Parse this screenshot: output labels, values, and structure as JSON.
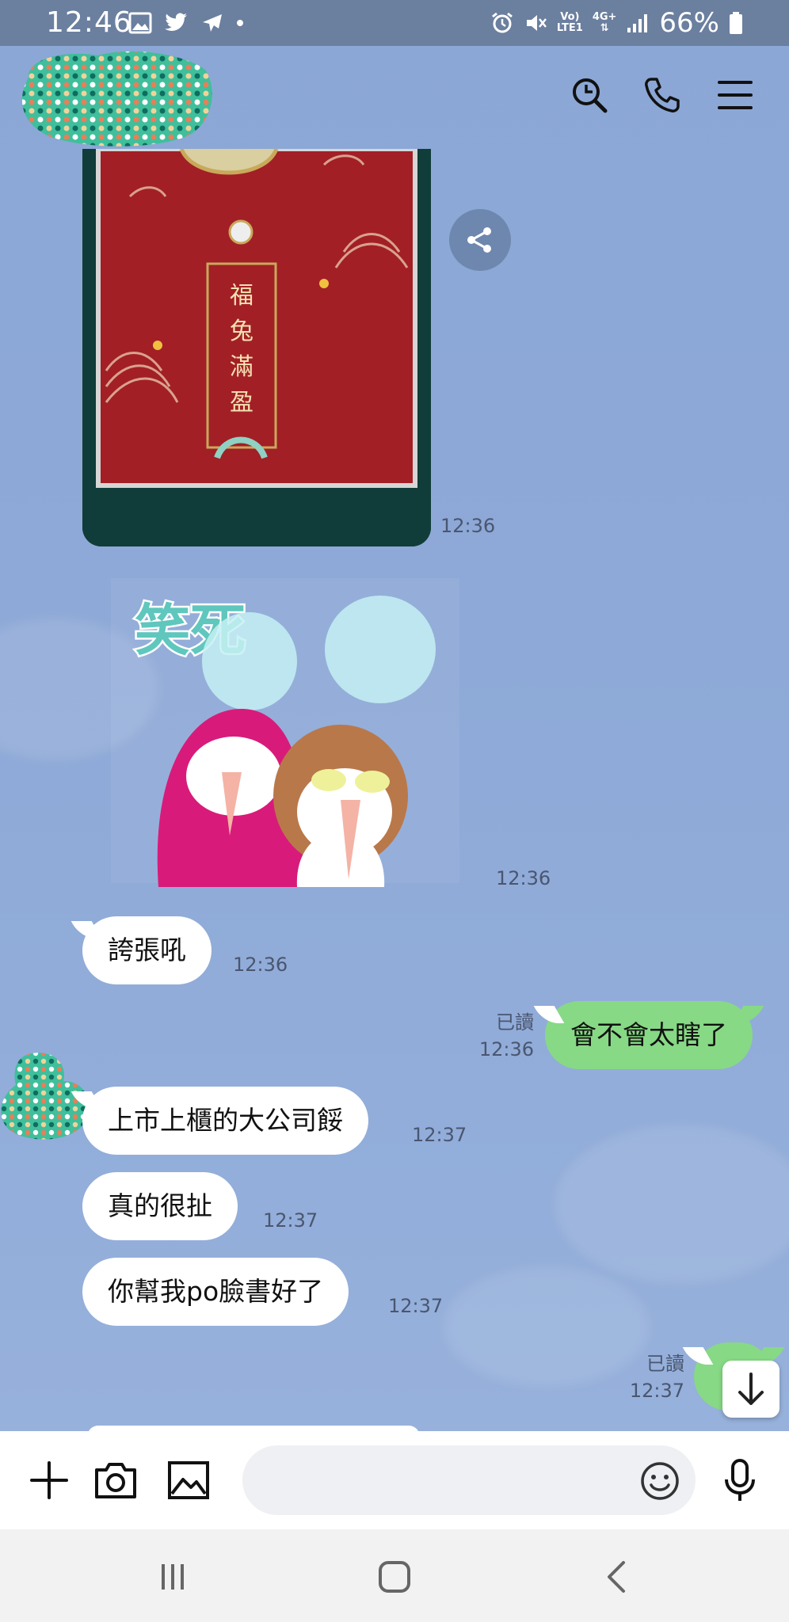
{
  "status_bar": {
    "time": "12:46",
    "network_top": "Vo)",
    "network_bottom": "LTE1",
    "network_type": "4G+",
    "battery": "66%"
  },
  "header": {
    "icons": [
      "search-icon",
      "phone-icon",
      "menu-icon"
    ]
  },
  "image_message": {
    "vertical_text": "福兔滿盈",
    "time": "12:36"
  },
  "sticker_message": {
    "sticker_text": "笑死",
    "time": "12:36"
  },
  "messages": [
    {
      "text": "誇張吼",
      "time": "12:36",
      "side": "received"
    },
    {
      "text": "會不會太瞎了",
      "time": "12:36",
      "side": "sent",
      "read_label": "已讀"
    },
    {
      "text": "上市上櫃的大公司餒",
      "time": "12:37",
      "side": "received"
    },
    {
      "text": "真的很扯",
      "time": "12:37",
      "side": "received"
    },
    {
      "text": "你幫我po臉書好了",
      "time": "12:37",
      "side": "received"
    },
    {
      "text": "",
      "time": "12:37",
      "side": "sent",
      "read_label": "已讀"
    }
  ],
  "input_bar": {
    "placeholder": "",
    "icons": [
      "plus-icon",
      "camera-icon",
      "image-icon",
      "emoji-icon",
      "mic-icon"
    ]
  },
  "colors": {
    "chat_background": "#8ea9d7",
    "status_bar": "#6b7f9f",
    "sent_bubble": "#87d985",
    "received_bubble": "#ffffff"
  }
}
